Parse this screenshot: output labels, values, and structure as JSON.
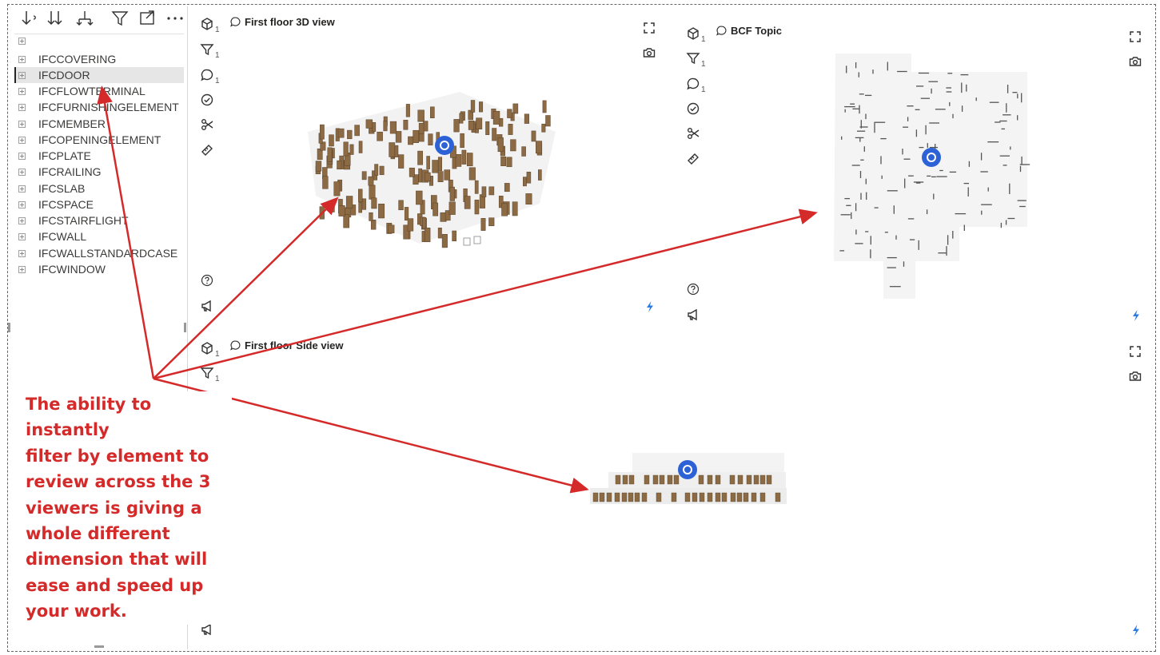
{
  "slicer": {
    "items": [
      {
        "label": ""
      },
      {
        "label": "IFCCOVERING"
      },
      {
        "label": "IFCDOOR",
        "selected": true
      },
      {
        "label": "IFCFLOWTERMINAL"
      },
      {
        "label": "IFCFURNISHINGELEMENT"
      },
      {
        "label": "IFCMEMBER"
      },
      {
        "label": "IFCOPENINGELEMENT"
      },
      {
        "label": "IFCPLATE"
      },
      {
        "label": "IFCRAILING"
      },
      {
        "label": "IFCSLAB"
      },
      {
        "label": "IFCSPACE"
      },
      {
        "label": "IFCSTAIRFLIGHT"
      },
      {
        "label": "IFCWALL"
      },
      {
        "label": "IFCWALLSTANDARDCASE"
      },
      {
        "label": "IFCWINDOW"
      }
    ],
    "toolbar_icons": [
      "sort-ascending-icon",
      "sort-descending-icon",
      "expand-hierarchy-icon",
      "filter-icon",
      "focus-mode-icon",
      "more-options-icon"
    ]
  },
  "viewers": [
    {
      "title": "First floor 3D view",
      "counts": {
        "models": "1",
        "filters": "1",
        "comments": "1"
      }
    },
    {
      "title": "BCF Topic",
      "counts": {
        "models": "1",
        "filters": "1",
        "comments": "1"
      }
    },
    {
      "title": "First floor Side view",
      "counts": {
        "models": "1",
        "filters": "1"
      }
    }
  ],
  "annotation": {
    "text": "The ability to instantly\nfilter by element to\nreview across the 3\nviewers is giving a\nwhole different\ndimension that will\nease and speed up\nyour work."
  },
  "colors": {
    "annotation": "#d42a2a",
    "accent_blue": "#2c62d6",
    "door_wood": "#8b6a44"
  }
}
